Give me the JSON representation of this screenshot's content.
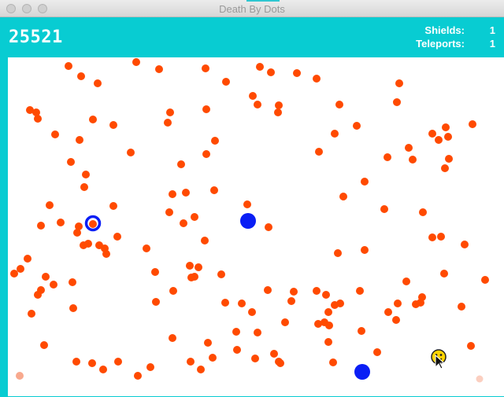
{
  "window": {
    "title": "Death By Dots"
  },
  "hud": {
    "score": "25521",
    "shields_label": "Shields:",
    "shields_value": "1",
    "teleports_label": "Teleports:",
    "teleports_value": "1"
  },
  "colors": {
    "accent": "#08ccd2",
    "enemy_dot": "#ff4a00",
    "fading_dot": "#f7a082",
    "blue_dot": "#0a1ef5",
    "player": "#ffd400"
  },
  "game": {
    "player_icon": "player-smiley-icon",
    "cursor_icon": "mouse-cursor-icon"
  }
}
